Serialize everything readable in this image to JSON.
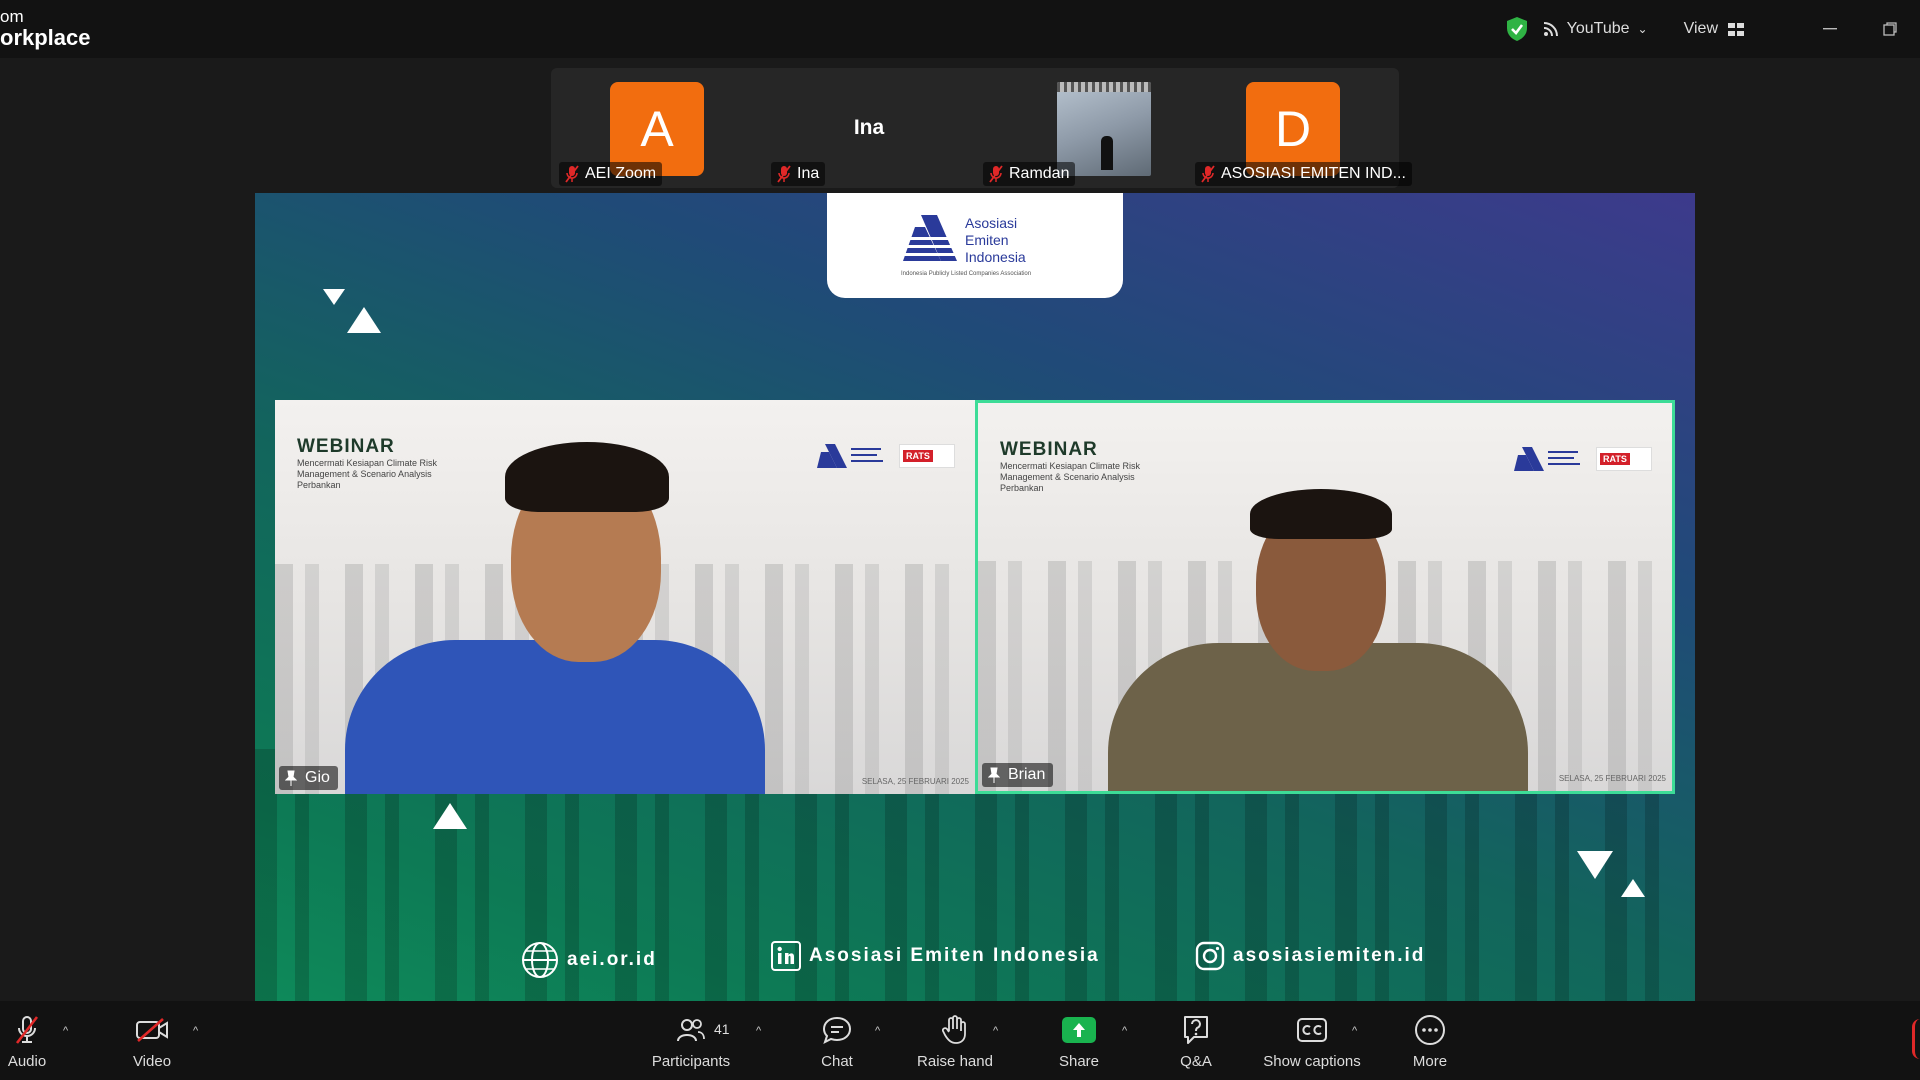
{
  "app": {
    "brand_line1": "om",
    "brand_line2": "orkplace"
  },
  "titlebar": {
    "stream_label": "YouTube",
    "view_label": "View"
  },
  "participants_strip": [
    {
      "type": "avatar",
      "initial": "A",
      "name": "AEI Zoom"
    },
    {
      "type": "name",
      "display": "Ina",
      "name": "Ina"
    },
    {
      "type": "photo",
      "name": "Ramdan"
    },
    {
      "type": "avatar",
      "initial": "D",
      "name": "ASOSIASI EMITEN IND..."
    }
  ],
  "shared_screen": {
    "logo_text": [
      "Asosiasi",
      "Emiten",
      "Indonesia"
    ],
    "logo_tagline": "Indonesia Publicly Listed Companies Association",
    "videos": [
      {
        "name": "Gio",
        "title": "WEBINAR",
        "subtitle": "Mencermati Kesiapan Climate Risk Management & Scenario Analysis Perbankan",
        "date": "SELASA, 25 FEBRUARI 2025",
        "partner": "RATS"
      },
      {
        "name": "Brian",
        "title": "WEBINAR",
        "subtitle": "Mencermati Kesiapan Climate Risk Management & Scenario Analysis Perbankan",
        "date": "SELASA, 25 FEBRUARI 2025",
        "partner": "RATS"
      }
    ],
    "links": {
      "website": "aei.or.id",
      "linkedin": "Asosiasi Emiten Indonesia",
      "instagram": "asosiasiemiten.id"
    }
  },
  "toolbar": {
    "audio": "Audio",
    "video": "Video",
    "participants": "Participants",
    "participants_count": "41",
    "chat": "Chat",
    "raise_hand": "Raise hand",
    "share": "Share",
    "qa": "Q&A",
    "captions": "Show captions",
    "more": "More"
  },
  "colors": {
    "accent_green": "#3ddc97",
    "avatar_orange": "#f26d0f",
    "share_green": "#19b34f",
    "mute_red": "#e02828"
  }
}
